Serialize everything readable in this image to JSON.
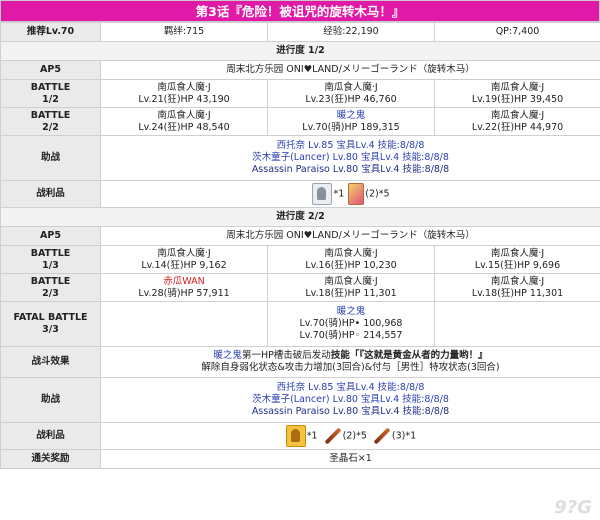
{
  "title": "第3话『危险！被诅咒的旋转木马！』",
  "header": {
    "recommend": "推荐Lv.70",
    "bond": "羁绊:715",
    "exp": "经验:22,190",
    "qp": "QP:7,400"
  },
  "progress1": {
    "label": "进行度 1/2",
    "ap": "AP5",
    "location": "周末北方乐园 ONI♥LAND/メリーゴーランド（旋转木马）",
    "b1": {
      "label_a": "BATTLE",
      "label_b": "1/2",
      "enemies": [
        {
          "name": "南瓜食人魔·J",
          "stat": "Lv.21(狂)HP 43,190"
        },
        {
          "name": "南瓜食人魔·J",
          "stat": "Lv.23(狂)HP 46,760"
        },
        {
          "name": "南瓜食人魔·J",
          "stat": "Lv.19(狂)HP 39,450"
        }
      ]
    },
    "b2": {
      "label_a": "BATTLE",
      "label_b": "2/2",
      "enemies": [
        {
          "name": "南瓜食人魔·J",
          "stat": "Lv.24(狂)HP 48,540"
        },
        {
          "name": "暖之鬼",
          "stat": "Lv.70(骑)HP 189,315"
        },
        {
          "name": "南瓜食人魔·J",
          "stat": "Lv.22(狂)HP 44,970"
        }
      ]
    },
    "support_label": "助战",
    "support": [
      "西托奈 Lv.85 宝具Lv.4 技能:8/8/8",
      "茨木童子(Lancer) Lv.80 宝具Lv.4 技能:8/8/8",
      "Assassin Paraiso Lv.80 宝具Lv.4 技能:8/8/8"
    ],
    "drops_label": "战利品",
    "drops": {
      "a": "*1",
      "b": "(2)*5"
    }
  },
  "progress2": {
    "label": "进行度 2/2",
    "ap": "AP5",
    "location": "周末北方乐园 ONI♥LAND/メリーゴーランド（旋转木马）",
    "b1": {
      "label_a": "BATTLE",
      "label_b": "1/3",
      "enemies": [
        {
          "name": "南瓜食人魔·J",
          "stat": "Lv.14(狂)HP 9,162"
        },
        {
          "name": "南瓜食人魔·J",
          "stat": "Lv.16(狂)HP 10,230"
        },
        {
          "name": "南瓜食人魔·J",
          "stat": "Lv.15(狂)HP 9,696"
        }
      ]
    },
    "b2": {
      "label_a": "BATTLE",
      "label_b": "2/3",
      "enemies": [
        {
          "name": "赤瓜WAN",
          "stat": "Lv.28(骑)HP 57,911"
        },
        {
          "name": "南瓜食人魔·J",
          "stat": "Lv.18(狂)HP 11,301"
        },
        {
          "name": "南瓜食人魔·J",
          "stat": "Lv.18(狂)HP 11,301"
        }
      ]
    },
    "fatal": {
      "label_a": "FATAL BATTLE",
      "label_b": "3/3",
      "name": "暖之鬼",
      "hp1": "Lv.70(骑)HP• 100,968",
      "hp2": "Lv.70(骑)HP◦ 214,557"
    },
    "effect_label": "战斗效果",
    "effect": {
      "name": "暖之鬼",
      "line1_mid": "第一HP槽击破后发动",
      "line1_bold": "技能「『这就是黄金从者的力量哟！』",
      "line2": "解除自身弱化状态&攻击力增加(3回合)&付与［男性］特攻状态(3回合)"
    },
    "support_label": "助战",
    "support": [
      "西托奈 Lv.85 宝具Lv.4 技能:8/8/8",
      "茨木童子(Lancer) Lv.80 宝具Lv.4 技能:8/8/8",
      "Assassin Paraiso Lv.80 宝具Lv.4 技能:8/8/8"
    ],
    "drops_label": "战利品",
    "drops": {
      "a": "*1",
      "b": "(2)*5",
      "c": "(3)*1"
    },
    "reward_label": "通关奖励",
    "reward": "圣晶石×1"
  },
  "icons": [
    "skull-ghost-icon",
    "gold-ghost-icon",
    "card-icon",
    "stick-icon"
  ],
  "colors": {
    "title_bg": "#e01aa6",
    "link_blue": "#2b3fb5",
    "enemy_red": "#d61f1f",
    "header_gray": "#eaeaea"
  },
  "watermark": "9?G"
}
